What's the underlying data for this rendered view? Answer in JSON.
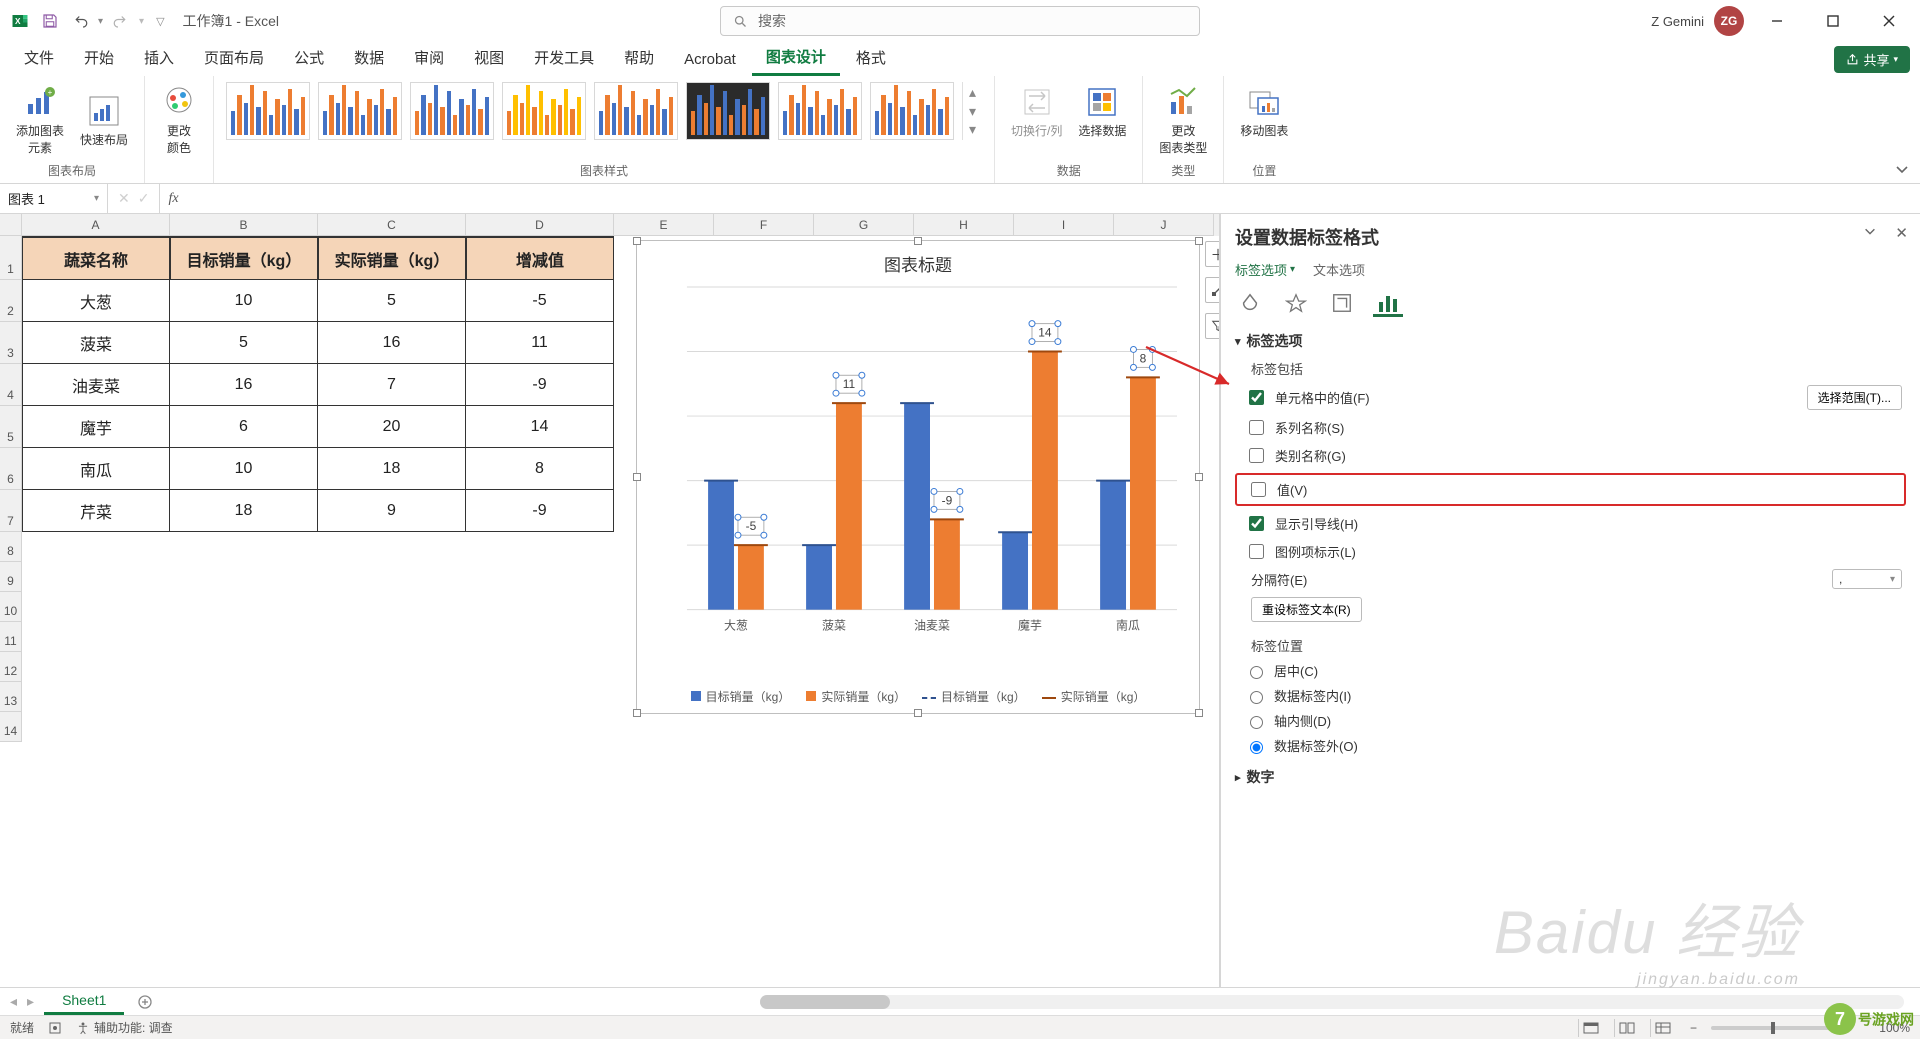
{
  "titlebar": {
    "doc_title": "工作簿1 - Excel",
    "search_placeholder": "搜索",
    "user_name": "Z Gemini",
    "user_initials": "ZG"
  },
  "ribbon_tabs": [
    "文件",
    "开始",
    "插入",
    "页面布局",
    "公式",
    "数据",
    "审阅",
    "视图",
    "开发工具",
    "帮助",
    "Acrobat",
    "图表设计",
    "格式"
  ],
  "ribbon_active_tab": "图表设计",
  "share_label": "共享",
  "ribbon": {
    "group_layout": {
      "label": "图表布局",
      "btn_add": "添加图表\n元素",
      "btn_quick": "快速布局"
    },
    "group_color": {
      "label": "",
      "btn": "更改\n颜色"
    },
    "group_styles": {
      "label": "图表样式"
    },
    "group_data": {
      "label": "数据",
      "btn_switch": "切换行/列",
      "btn_select": "选择数据"
    },
    "group_type": {
      "label": "类型",
      "btn": "更改\n图表类型"
    },
    "group_pos": {
      "label": "位置",
      "btn": "移动图表"
    }
  },
  "formula_bar": {
    "name_box": "图表 1"
  },
  "columns": [
    "A",
    "B",
    "C",
    "D",
    "E",
    "F",
    "G",
    "H",
    "I",
    "J"
  ],
  "table": {
    "headers": [
      "蔬菜名称",
      "目标销量（kg）",
      "实际销量（kg）",
      "增减值"
    ],
    "rows": [
      {
        "name": "大葱",
        "target": "10",
        "actual": "5",
        "delta": "-5"
      },
      {
        "name": "菠菜",
        "target": "5",
        "actual": "16",
        "delta": "11"
      },
      {
        "name": "油麦菜",
        "target": "16",
        "actual": "7",
        "delta": "-9"
      },
      {
        "name": "魔芋",
        "target": "6",
        "actual": "20",
        "delta": "14"
      },
      {
        "name": "南瓜",
        "target": "10",
        "actual": "18",
        "delta": "8"
      },
      {
        "name": "芹菜",
        "target": "18",
        "actual": "9",
        "delta": "-9"
      }
    ]
  },
  "chart_data": {
    "type": "bar",
    "title": "图表标题",
    "categories": [
      "大葱",
      "菠菜",
      "油麦菜",
      "魔芋",
      "南瓜"
    ],
    "series": [
      {
        "name": "目标销量（kg）",
        "values": [
          10,
          5,
          16,
          6,
          10
        ],
        "color": "#4472c4"
      },
      {
        "name": "实际销量（kg）",
        "values": [
          5,
          16,
          7,
          20,
          18
        ],
        "color": "#ed7d31"
      }
    ],
    "data_labels": [
      "-5",
      "11",
      "-9",
      "14",
      "8"
    ],
    "label_y": [
      5,
      16,
      7,
      20,
      18
    ],
    "ylim": [
      0,
      25
    ],
    "yticks": [
      0,
      5,
      10,
      15,
      20,
      25
    ],
    "legend": [
      "目标销量（kg）",
      "实际销量（kg）",
      "目标销量（kg）",
      "实际销量（kg）"
    ],
    "legend_markers": [
      "bar-blue",
      "bar-orange",
      "line-blue",
      "line-orange"
    ]
  },
  "format_panel": {
    "title": "设置数据标签格式",
    "tab_label_options": "标签选项",
    "tab_text_options": "文本选项",
    "section": "标签选项",
    "sub_includes": "标签包括",
    "chk_cell_value": "单元格中的值(F)",
    "btn_select_range": "选择范围(T)...",
    "chk_series_name": "系列名称(S)",
    "chk_category_name": "类别名称(G)",
    "chk_value": "值(V)",
    "chk_leader_lines": "显示引导线(H)",
    "chk_legend_key": "图例项标示(L)",
    "separator_label": "分隔符(E)",
    "separator_value": ",",
    "btn_reset": "重设标签文本(R)",
    "sub_position": "标签位置",
    "radio_center": "居中(C)",
    "radio_inside_end": "数据标签内(I)",
    "radio_inside_base": "轴内侧(D)",
    "radio_outside_end": "数据标签外(O)",
    "nav_number": "数字"
  },
  "sheet_tabs": {
    "active": "Sheet1"
  },
  "statusbar": {
    "ready": "就绪",
    "accessibility": "辅助功能: 调查",
    "zoom": "100%"
  },
  "watermark": {
    "main": "Baidu 经验",
    "sub": "jingyan.baidu.com"
  },
  "logo7": "号游戏网"
}
